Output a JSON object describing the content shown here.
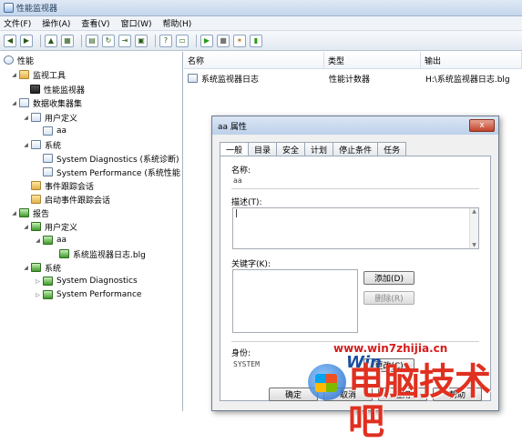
{
  "window": {
    "title": "性能监视器"
  },
  "menu": [
    "文件(F)",
    "操作(A)",
    "查看(V)",
    "窗口(W)",
    "帮助(H)"
  ],
  "tree": {
    "root": "性能",
    "monitoring_tools": "监视工具",
    "perf_monitor": "性能监视器",
    "data_collector_sets": "数据收集器集",
    "user_defined": "用户定义",
    "aa": "aa",
    "system": "系统",
    "sys_diag": "System Diagnostics (系统诊断)",
    "sys_perf": "System Performance (系统性能",
    "event_trace": "事件跟踪会话",
    "startup_trace": "启动事件跟踪会话",
    "reports": "报告",
    "r_user_defined": "用户定义",
    "r_aa": "aa",
    "r_log": "系统监视器日志.blg",
    "r_system": "系统",
    "r_sys_diag": "System Diagnostics",
    "r_sys_perf": "System Performance"
  },
  "list": {
    "headers": [
      "名称",
      "类型",
      "输出"
    ],
    "rows": [
      {
        "name": "系统监视器日志",
        "type": "性能计数器",
        "output": "H:\\系统监视器日志.blg"
      }
    ]
  },
  "dialog": {
    "title": "aa 属性",
    "close": "x",
    "tabs": [
      "一般",
      "目录",
      "安全",
      "计划",
      "停止条件",
      "任务"
    ],
    "name_label": "名称:",
    "name_value": "aa",
    "desc_label": "描述(T):",
    "desc_value": "|",
    "keywords_label": "关键字(K):",
    "add_btn": "添加(D)",
    "remove_btn": "删除(R)",
    "identity_label": "身份:",
    "identity_value": "SYSTEM",
    "change_btn": "更改(C)",
    "ok_btn": "确定",
    "cancel_btn": "取消",
    "apply_btn": "应用",
    "help_btn": "帮助"
  },
  "watermark": {
    "url": "www.win7zhijia.cn",
    "brand": "电脑技术吧",
    "win": "Win"
  }
}
